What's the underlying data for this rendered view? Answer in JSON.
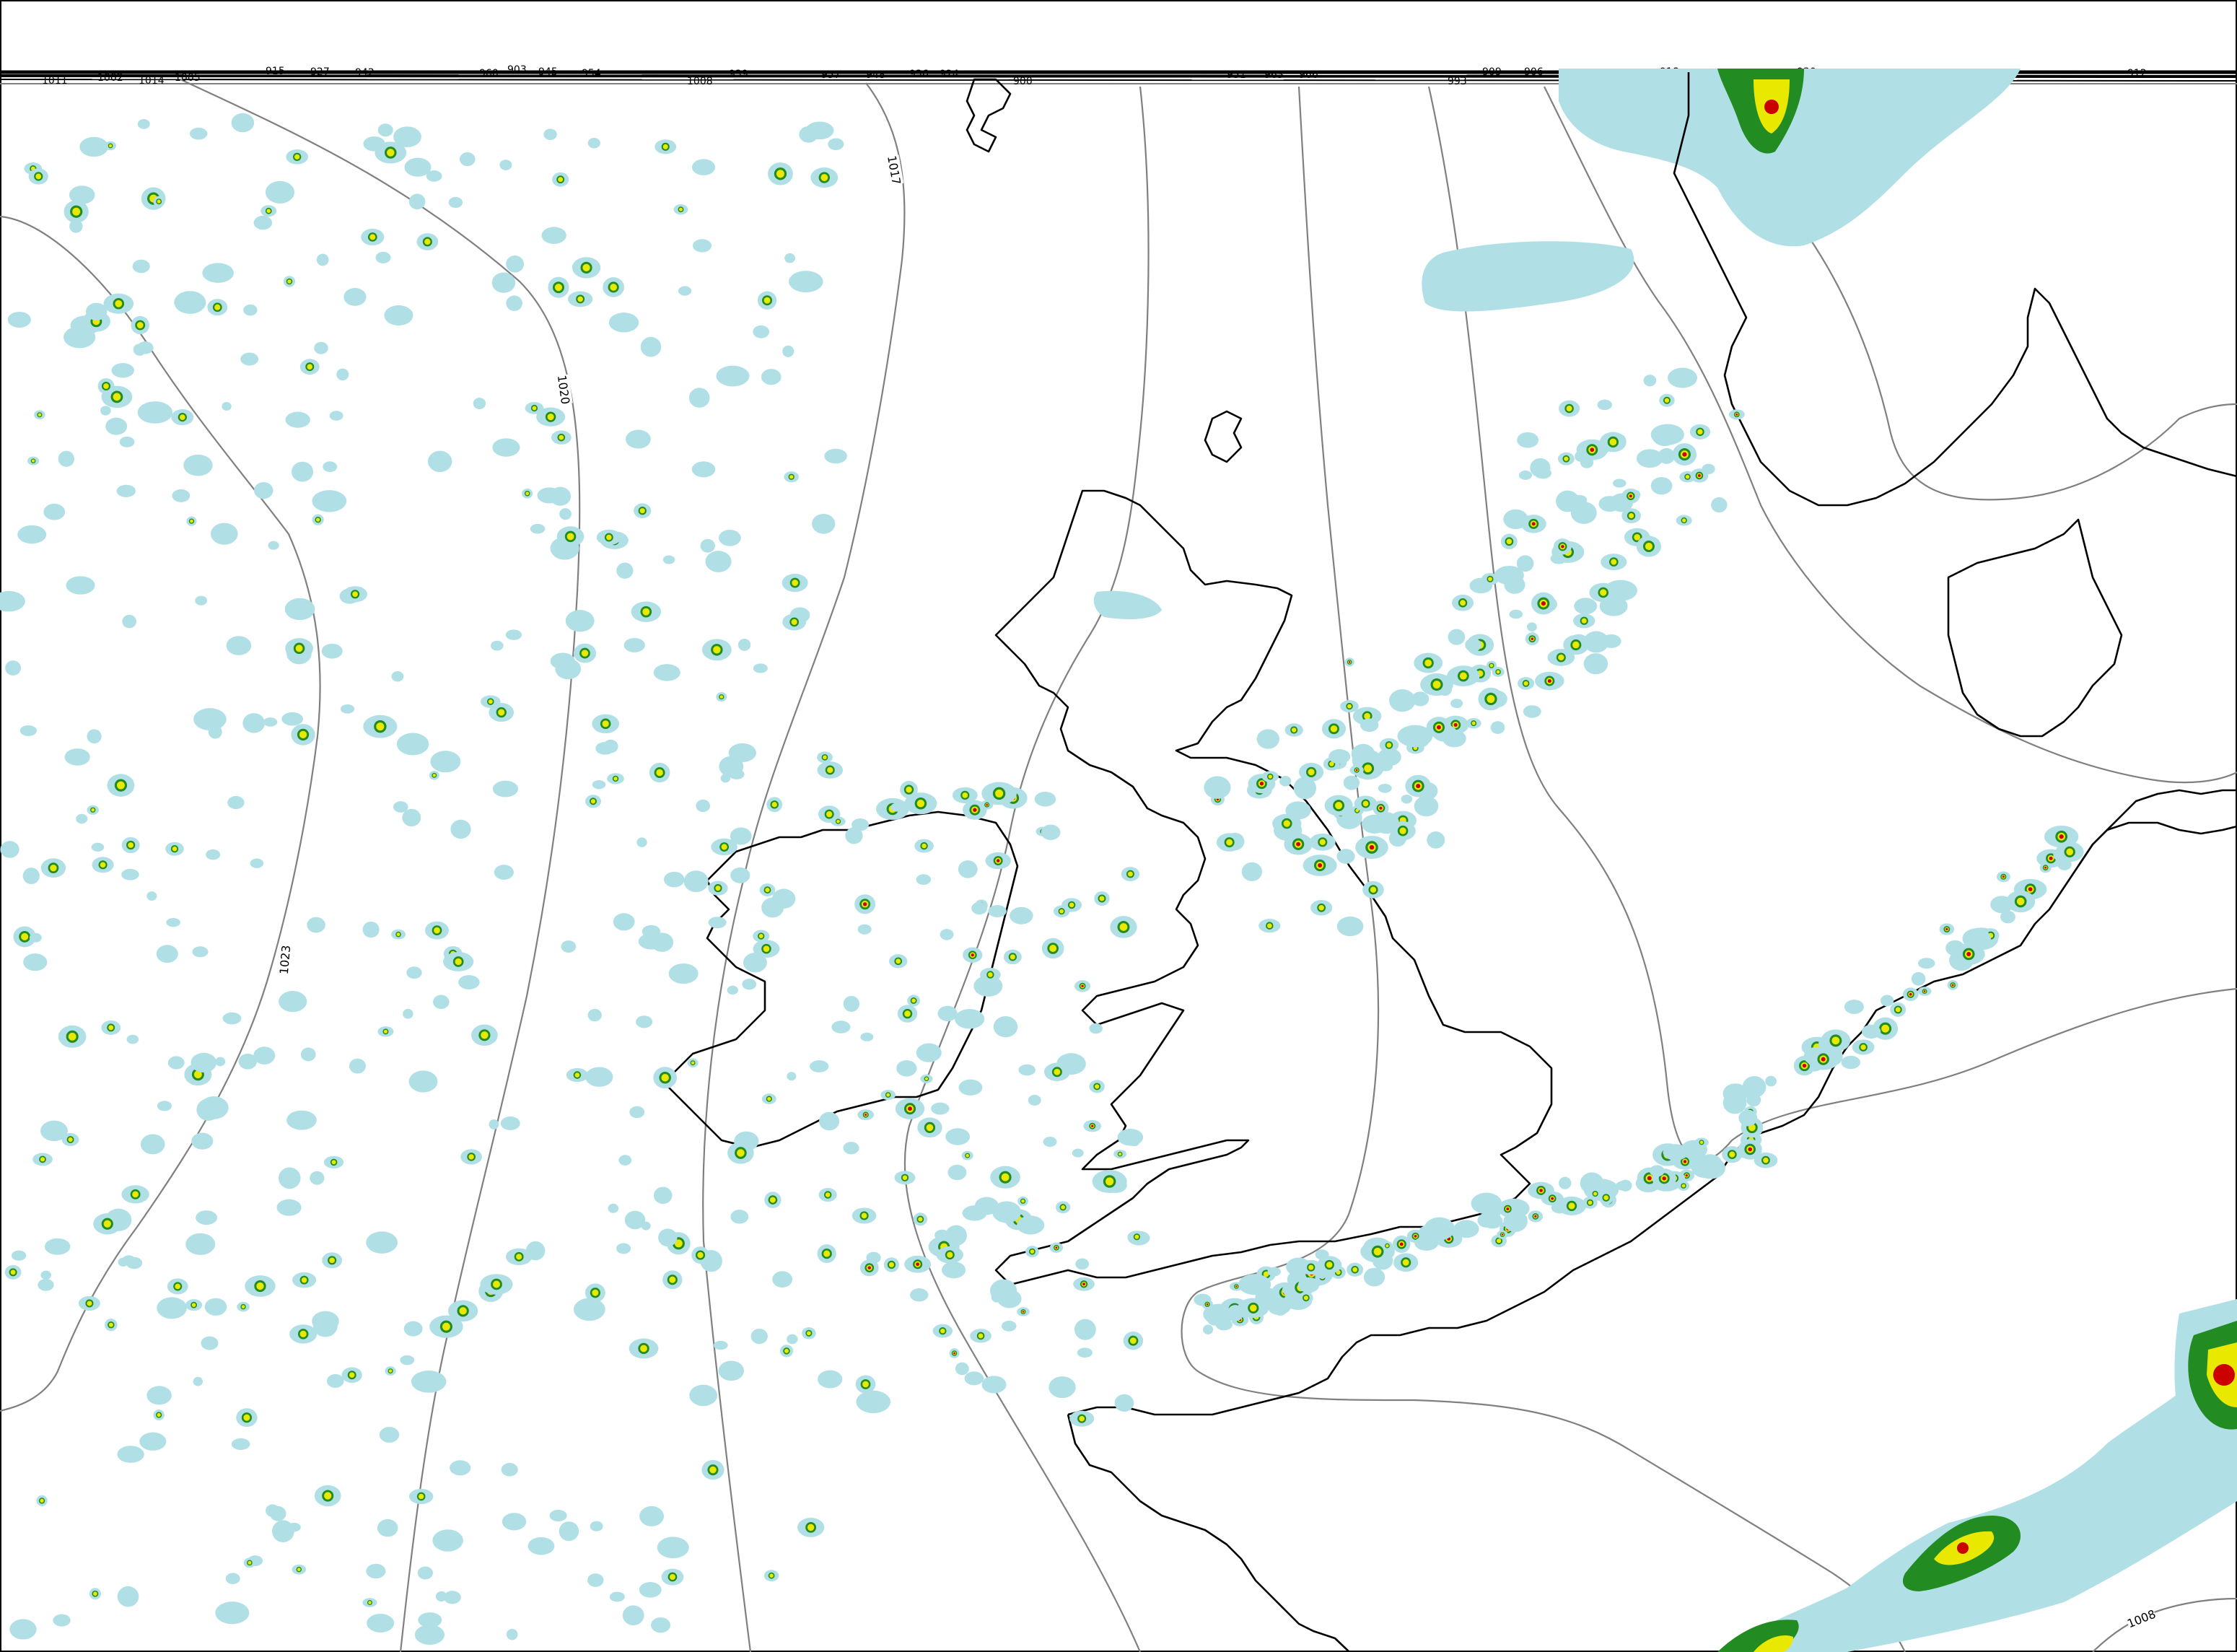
{
  "map": {
    "isobar_labels": [
      "1017",
      "1020",
      "1023",
      "1008"
    ],
    "top_edge_labels": [
      "1011",
      "1002",
      "1014",
      "1005",
      "915",
      "927",
      "942",
      "960",
      "903",
      "945",
      "954",
      "1008",
      "939",
      "957",
      "948",
      "936",
      "924",
      "900",
      "951",
      "963",
      "966",
      "993",
      "909",
      "906",
      "918",
      "930",
      "921",
      "933",
      "912"
    ]
  },
  "colors": {
    "frame": "#000000",
    "isobar": "#808080",
    "coastline": "#000000",
    "precip_light": "#b0e0e6",
    "precip_moderate": "#228b22",
    "precip_heavy_yellow": "#e8e800",
    "precip_heavy_red": "#cc0000"
  }
}
